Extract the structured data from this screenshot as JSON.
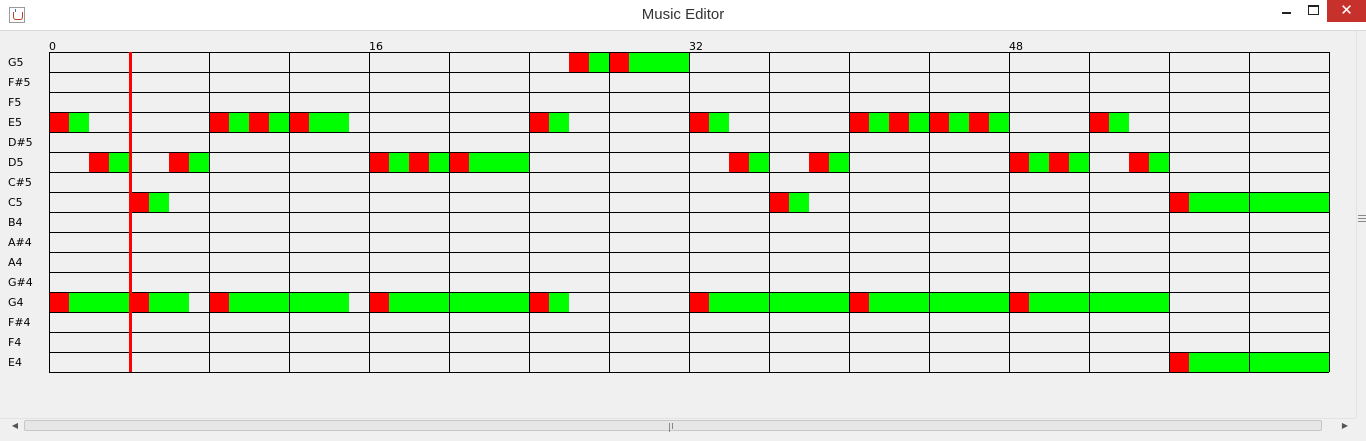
{
  "window": {
    "title": "Music Editor",
    "controls": {
      "minimize_icon": "minimize-icon",
      "maximize_icon": "maximize-icon",
      "close_label": "✕"
    },
    "app_icon": "java-cup-icon"
  },
  "editor": {
    "beat_labels": [
      "0",
      "16",
      "32",
      "48"
    ],
    "beat_label_beats": [
      0,
      16,
      32,
      48
    ],
    "total_beats": 64,
    "measure_length": 4,
    "pitches": [
      "G5",
      "F#5",
      "F5",
      "E5",
      "D#5",
      "D5",
      "C#5",
      "C5",
      "B4",
      "A#4",
      "A4",
      "G#4",
      "G4",
      "F#4",
      "F4",
      "E4"
    ],
    "playhead_beat": 4,
    "colors": {
      "note_head": "#ff0000",
      "note_sustain": "#00ff00",
      "playhead": "#ff0000",
      "grid_line": "#000000",
      "background": "#f0f0f0"
    },
    "notes": [
      {
        "pitch": "G5",
        "start": 26,
        "duration": 2
      },
      {
        "pitch": "G5",
        "start": 28,
        "duration": 4
      },
      {
        "pitch": "E5",
        "start": 0,
        "duration": 2
      },
      {
        "pitch": "E5",
        "start": 8,
        "duration": 2
      },
      {
        "pitch": "E5",
        "start": 10,
        "duration": 2
      },
      {
        "pitch": "E5",
        "start": 12,
        "duration": 3
      },
      {
        "pitch": "E5",
        "start": 24,
        "duration": 2
      },
      {
        "pitch": "E5",
        "start": 32,
        "duration": 2
      },
      {
        "pitch": "E5",
        "start": 40,
        "duration": 2
      },
      {
        "pitch": "E5",
        "start": 42,
        "duration": 2
      },
      {
        "pitch": "E5",
        "start": 44,
        "duration": 2
      },
      {
        "pitch": "E5",
        "start": 46,
        "duration": 2
      },
      {
        "pitch": "E5",
        "start": 52,
        "duration": 2
      },
      {
        "pitch": "D5",
        "start": 2,
        "duration": 2
      },
      {
        "pitch": "D5",
        "start": 6,
        "duration": 2
      },
      {
        "pitch": "D5",
        "start": 16,
        "duration": 2
      },
      {
        "pitch": "D5",
        "start": 18,
        "duration": 2
      },
      {
        "pitch": "D5",
        "start": 20,
        "duration": 4
      },
      {
        "pitch": "D5",
        "start": 34,
        "duration": 2
      },
      {
        "pitch": "D5",
        "start": 38,
        "duration": 2
      },
      {
        "pitch": "D5",
        "start": 48,
        "duration": 2
      },
      {
        "pitch": "D5",
        "start": 50,
        "duration": 2
      },
      {
        "pitch": "D5",
        "start": 54,
        "duration": 2
      },
      {
        "pitch": "C5",
        "start": 4,
        "duration": 2
      },
      {
        "pitch": "C5",
        "start": 36,
        "duration": 2
      },
      {
        "pitch": "C5",
        "start": 56,
        "duration": 8
      },
      {
        "pitch": "G4",
        "start": 0,
        "duration": 4
      },
      {
        "pitch": "G4",
        "start": 4,
        "duration": 3
      },
      {
        "pitch": "G4",
        "start": 8,
        "duration": 7
      },
      {
        "pitch": "G4",
        "start": 16,
        "duration": 8
      },
      {
        "pitch": "G4",
        "start": 24,
        "duration": 2
      },
      {
        "pitch": "G4",
        "start": 32,
        "duration": 8
      },
      {
        "pitch": "G4",
        "start": 40,
        "duration": 8
      },
      {
        "pitch": "G4",
        "start": 48,
        "duration": 8
      },
      {
        "pitch": "E4",
        "start": 56,
        "duration": 8
      }
    ]
  }
}
